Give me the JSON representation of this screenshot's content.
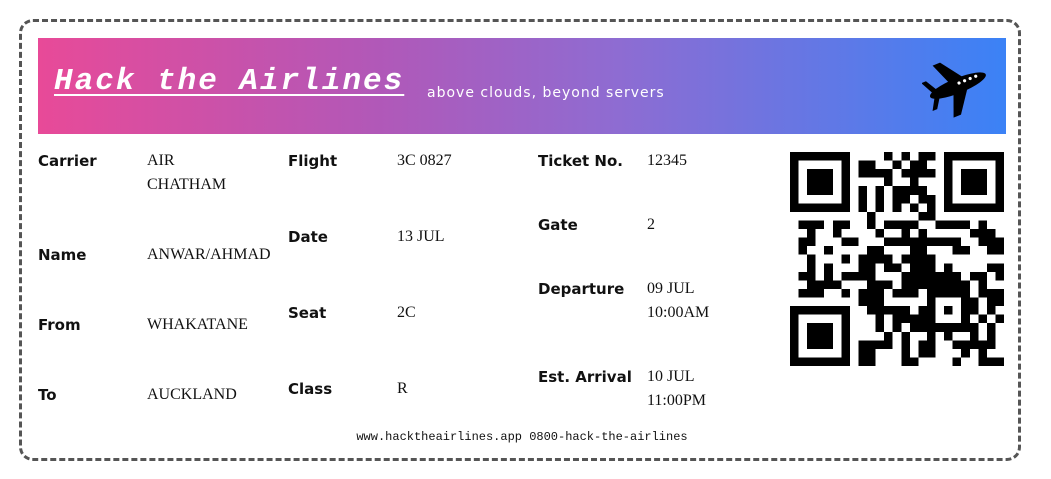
{
  "header": {
    "title": "Hack the Airlines",
    "subtitle": "above clouds, beyond servers"
  },
  "icons": {
    "plane": "airplane-icon",
    "qr": "qr-code"
  },
  "colors": {
    "gradient_start": "#e84a98",
    "gradient_end": "#3b82f6",
    "border": "#555555"
  },
  "left": {
    "carrier_label": "Carrier",
    "carrier_line1": "AIR",
    "carrier_line2": "CHATHAM",
    "name_label": "Name",
    "name_value": "ANWAR/AHMAD",
    "from_label": "From",
    "from_value": "WHAKATANE",
    "to_label": "To",
    "to_value": "AUCKLAND"
  },
  "middle": {
    "flight_label": "Flight",
    "flight_value": "3C 0827",
    "date_label": "Date",
    "date_value": "13 JUL",
    "seat_label": "Seat",
    "seat_value": "2C",
    "class_label": "Class",
    "class_value": "R"
  },
  "right": {
    "ticket_label": "Ticket No.",
    "ticket_value": "12345",
    "gate_label": "Gate",
    "gate_value": "2",
    "departure_label": "Departure",
    "departure_line1": "09 JUL",
    "departure_line2": "10:00AM",
    "arrival_label": "Est. Arrival",
    "arrival_line1": "10 JUL",
    "arrival_line2": "11:00PM"
  },
  "footer": {
    "text": "www.hacktheairlines.app 0800-hack-the-airlines"
  }
}
